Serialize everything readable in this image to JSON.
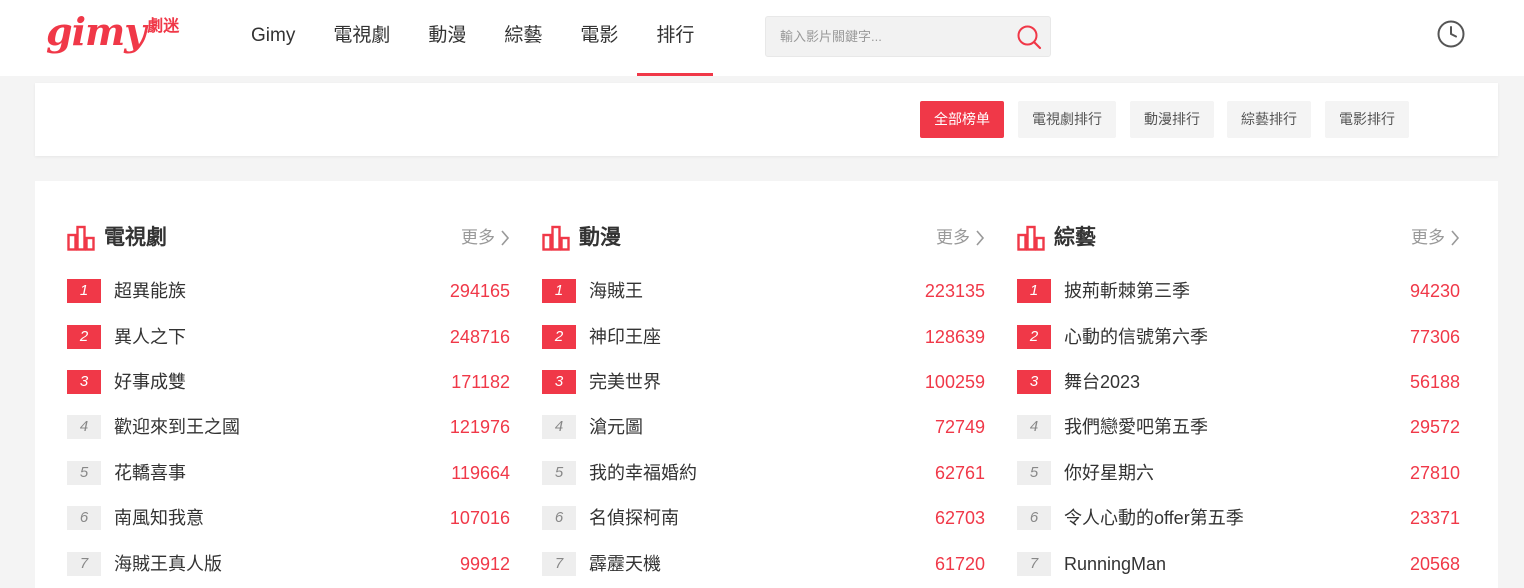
{
  "logo": {
    "main": "gimy",
    "sub": "劇迷"
  },
  "nav": [
    "Gimy",
    "電視劇",
    "動漫",
    "綜藝",
    "電影",
    "排行"
  ],
  "nav_active": "排行",
  "search": {
    "placeholder": "輸入影片關鍵字..."
  },
  "icons": {
    "search": "search-icon",
    "history": "clock-icon",
    "rank": "bar-chart-icon",
    "more": "chevron-right-icon"
  },
  "colors": {
    "accent": "#f03848"
  },
  "filters": [
    "全部榜单",
    "電視劇排行",
    "動漫排行",
    "綜藝排行",
    "電影排行"
  ],
  "filter_active": "全部榜单",
  "columns": [
    {
      "title": "電視劇",
      "more": "更多",
      "items": [
        {
          "rank": "1",
          "title": "超異能族",
          "count": "294165"
        },
        {
          "rank": "2",
          "title": "異人之下",
          "count": "248716"
        },
        {
          "rank": "3",
          "title": "好事成雙",
          "count": "171182"
        },
        {
          "rank": "4",
          "title": "歡迎來到王之國",
          "count": "121976"
        },
        {
          "rank": "5",
          "title": "花轎喜事",
          "count": "119664"
        },
        {
          "rank": "6",
          "title": "南風知我意",
          "count": "107016"
        },
        {
          "rank": "7",
          "title": "海賊王真人版",
          "count": "99912"
        }
      ]
    },
    {
      "title": "動漫",
      "more": "更多",
      "items": [
        {
          "rank": "1",
          "title": "海賊王",
          "count": "223135"
        },
        {
          "rank": "2",
          "title": "神印王座",
          "count": "128639"
        },
        {
          "rank": "3",
          "title": "完美世界",
          "count": "100259"
        },
        {
          "rank": "4",
          "title": "滄元圖",
          "count": "72749"
        },
        {
          "rank": "5",
          "title": "我的幸福婚約",
          "count": "62761"
        },
        {
          "rank": "6",
          "title": "名偵探柯南",
          "count": "62703"
        },
        {
          "rank": "7",
          "title": "霹靂天機",
          "count": "61720"
        }
      ]
    },
    {
      "title": "綜藝",
      "more": "更多",
      "items": [
        {
          "rank": "1",
          "title": "披荊斬棘第三季",
          "count": "94230"
        },
        {
          "rank": "2",
          "title": "心動的信號第六季",
          "count": "77306"
        },
        {
          "rank": "3",
          "title": "舞台2023",
          "count": "56188"
        },
        {
          "rank": "4",
          "title": "我們戀愛吧第五季",
          "count": "29572"
        },
        {
          "rank": "5",
          "title": "你好星期六",
          "count": "27810"
        },
        {
          "rank": "6",
          "title": "令人心動的offer第五季",
          "count": "23371"
        },
        {
          "rank": "7",
          "title": "RunningMan",
          "count": "20568"
        }
      ]
    }
  ]
}
